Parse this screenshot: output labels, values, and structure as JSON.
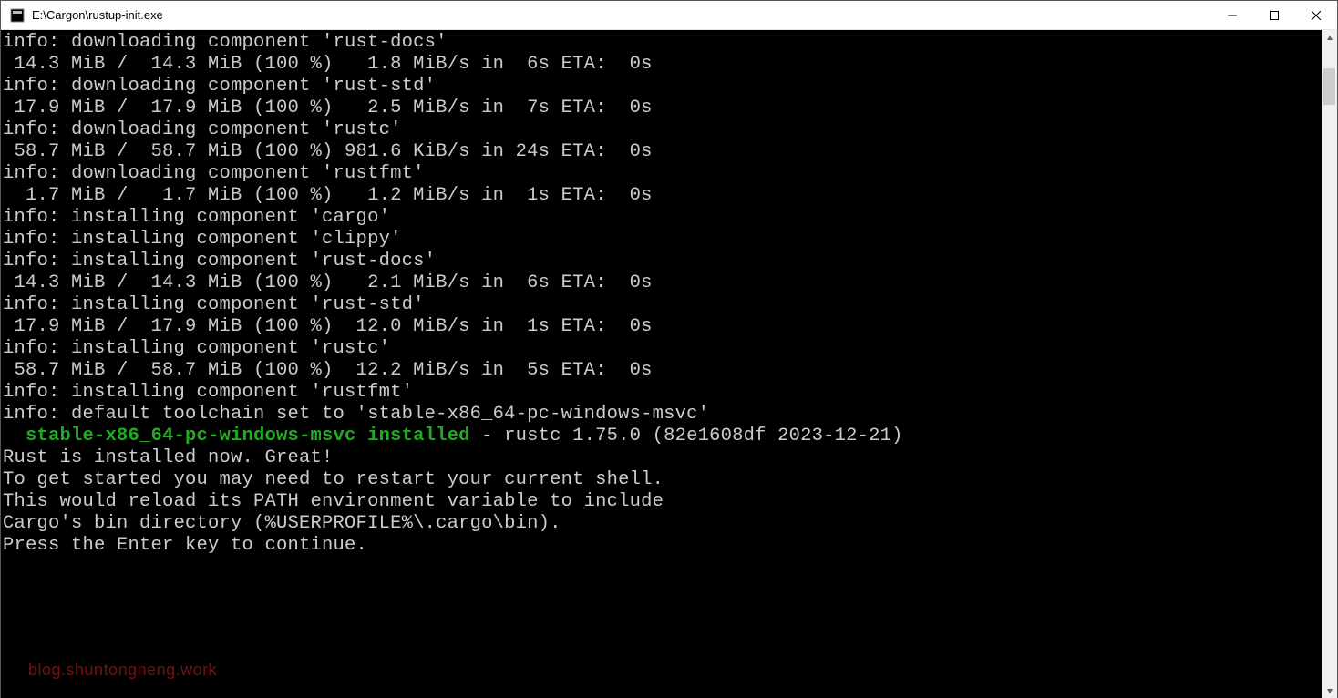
{
  "window": {
    "title": "E:\\Cargon\\rustup-init.exe"
  },
  "terminal": {
    "lines": [
      {
        "t": "info: downloading component 'rust-docs'"
      },
      {
        "t": " 14.3 MiB /  14.3 MiB (100 %)   1.8 MiB/s in  6s ETA:  0s"
      },
      {
        "t": "info: downloading component 'rust-std'"
      },
      {
        "t": " 17.9 MiB /  17.9 MiB (100 %)   2.5 MiB/s in  7s ETA:  0s"
      },
      {
        "t": "info: downloading component 'rustc'"
      },
      {
        "t": " 58.7 MiB /  58.7 MiB (100 %) 981.6 KiB/s in 24s ETA:  0s"
      },
      {
        "t": "info: downloading component 'rustfmt'"
      },
      {
        "t": "  1.7 MiB /   1.7 MiB (100 %)   1.2 MiB/s in  1s ETA:  0s"
      },
      {
        "t": "info: installing component 'cargo'"
      },
      {
        "t": "info: installing component 'clippy'"
      },
      {
        "t": "info: installing component 'rust-docs'"
      },
      {
        "t": " 14.3 MiB /  14.3 MiB (100 %)   2.1 MiB/s in  6s ETA:  0s"
      },
      {
        "t": "info: installing component 'rust-std'"
      },
      {
        "t": " 17.9 MiB /  17.9 MiB (100 %)  12.0 MiB/s in  1s ETA:  0s"
      },
      {
        "t": "info: installing component 'rustc'"
      },
      {
        "t": " 58.7 MiB /  58.7 MiB (100 %)  12.2 MiB/s in  5s ETA:  0s"
      },
      {
        "t": "info: installing component 'rustfmt'"
      },
      {
        "t": "info: default toolchain set to 'stable-x86_64-pc-windows-msvc'"
      },
      {
        "t": ""
      }
    ],
    "success_line": {
      "green_part": "  stable-x86_64-pc-windows-msvc installed",
      "rest": " - rustc 1.75.0 (82e1608df 2023-12-21)"
    },
    "tail": [
      "",
      "",
      "Rust is installed now. Great!",
      "",
      "To get started you may need to restart your current shell.",
      "This would reload its PATH environment variable to include",
      "Cargo's bin directory (%USERPROFILE%\\.cargo\\bin).",
      "",
      "Press the Enter key to continue."
    ]
  },
  "watermark": "blog.shuntongneng.work"
}
